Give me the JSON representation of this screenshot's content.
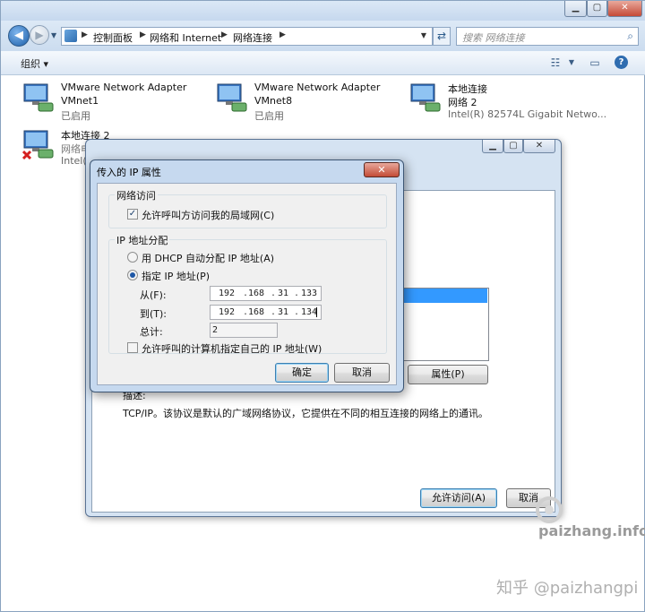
{
  "explorer": {
    "breadcrumb": [
      "控制面板",
      "网络和 Internet",
      "网络连接"
    ],
    "search_placeholder": "搜索 网络连接",
    "organize_label": "组织 ▾"
  },
  "adapters": [
    {
      "name": "VMware Network Adapter",
      "line2": "VMnet1",
      "status": "已启用"
    },
    {
      "name": "VMware Network Adapter",
      "line2": "VMnet8",
      "status": "已启用"
    },
    {
      "name": "本地连接",
      "line2": "网络  2",
      "status": "Intel(R) 82574L Gigabit Netwo..."
    },
    {
      "name": "本地连接 2",
      "line2": "网络电缆被拔出",
      "status": "Intel(R)"
    }
  ],
  "properties_dialog": {
    "properties_button": "属性(P)",
    "description_label": "描述:",
    "description_text": "TCP/IP。该协议是默认的广域网络协议，它提供在不同的相互连接的网络上的通讯。",
    "allow_access_button": "允许访问(A)",
    "cancel_button": "取消"
  },
  "ip_dialog": {
    "title": "传入的 IP 属性",
    "close_glyph": "✕",
    "network_access_group": "网络访问",
    "allow_lan_access": "允许呼叫方访问我的局域网(C)",
    "allow_lan_access_checked": true,
    "ip_assign_group": "IP 地址分配",
    "dhcp_option": "用 DHCP 自动分配 IP 地址(A)",
    "static_option": "指定 IP 地址(P)",
    "from_label": "从(F):",
    "from_ip": [
      "192",
      "168",
      "31",
      "133"
    ],
    "to_label": "到(T):",
    "to_ip": [
      "192",
      "168",
      "31",
      "134"
    ],
    "total_label": "总计:",
    "total_value": "2",
    "allow_own_ip": "允许呼叫的计算机指定自己的 IP 地址(W)",
    "allow_own_ip_checked": false,
    "ok_button": "确定",
    "cancel_button": "取消"
  },
  "watermarks": {
    "site": "paizhang.info",
    "zhihu": "知乎 @paizhangpi"
  },
  "colors": {
    "selection": "#3399ff",
    "dialog_frame": "#c6d9ef",
    "close_red": "#c34b36"
  }
}
